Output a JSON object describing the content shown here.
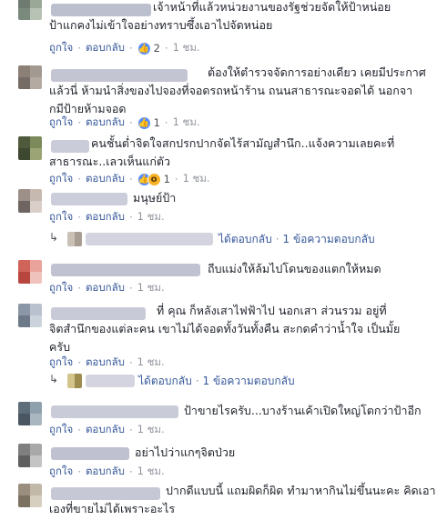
{
  "actions": {
    "like": "ถูกใจ",
    "reply": "ตอบกลับ",
    "dot": "·"
  },
  "colors": {
    "link": "#365899",
    "meta": "#90949c",
    "text": "#1d2129",
    "like_icon": "#5890ff",
    "wow_icon": "#f7b125"
  },
  "icons": {
    "like": "thumbs-up-icon",
    "wow": "wow-face-icon",
    "reply_arrow": "reply-arrow-icon"
  },
  "comments": [
    {
      "text": "เจ้าหน้าที่แล้วหน่วยงานของรัฐช่วยจัดให้ป้าหน่อย\nป้าแกคงไม่เข้าใจอย่างทราบซึ้งเอาไปจัดหน่อย",
      "reactions": "2",
      "time": "1 ชม.",
      "avatar": [
        "#6f7a70",
        "#9aa898",
        "#7a8a7d",
        "#b7c2b4"
      ],
      "name_blur": "#a6a9bd"
    },
    {
      "text": "ต้องให้ตำรวจจัดการอย่างเดียว เคยมีประกาศ\nแล้วนี่ ห้ามนำสิ่งของไปจองที่จอดรถหน้าร้าน ถนนสาธารณะจอดได้ นอกจา\nกมีป้ายห้ามจอด",
      "reactions": "1",
      "time": "1 ชม.",
      "avatar": [
        "#8c7f76",
        "#a29990",
        "#756c66",
        "#b5aaa2"
      ],
      "name_blur": "#b0b2c4"
    },
    {
      "text": "คนชั้นต่ำจิตใจสกปรกปากจัดไร้สามัญสำนึก..แจ้งความเลยคะที่\nสาธารณะ..เลวเห็นแก่ตัว",
      "reactions": "1",
      "time": "1 ชม.",
      "avatar": [
        "#4f5a3c",
        "#7c8a5b",
        "#3e4830",
        "#9aa474"
      ],
      "name_blur": "#b8bbcd"
    },
    {
      "text": "มนุษย์ป้า",
      "time": "1 ชม.",
      "avatar": [
        "#9c9088",
        "#c5b9b0",
        "#6e6562",
        "#d9cfc8"
      ],
      "name_blur": "#b9bccd"
    },
    {
      "text": "ถีบแม่งให้ล้มไปโดนของแตกให้หมด",
      "time": "1 ชม.",
      "avatar": [
        "#d0645a",
        "#e9a39b",
        "#b8463e",
        "#f0c2bc"
      ],
      "name_blur": "#abaec2"
    },
    {
      "text": "ที่ คุณ ก็หลังเสาไฟฟ้าไป นอกเสา ส่วนรวม อยู่ที่\nจิตสำนึกของแต่ละคน เขาไม่ได้จอดทั้งวันทั้งคืน สะกดคำว่าน้ำใจ เป็นมั้ย\nครับ",
      "time": "1 ชม.",
      "avatar": [
        "#8b96a6",
        "#b8c1cd",
        "#6d7888",
        "#ccd3dc"
      ],
      "name_blur": "#b5b8ca"
    },
    {
      "text": "ป้าขายไรครับ...บางร้านเค้าเปิดใหญ่โตกว่าป้าอีก",
      "time": "1 ชม.",
      "avatar": [
        "#5e6d7a",
        "#8fa0ad",
        "#4a5763",
        "#a9b7c1"
      ],
      "name_blur": "#b7bacc"
    },
    {
      "text": "อย่าไปว่าแกๆจิตป่วย",
      "time": "1 ชม.",
      "avatar": [
        "#7f7f7f",
        "#a8a8a8",
        "#5f5f5f",
        "#c4c4c4"
      ],
      "name_blur": "#a9abc0"
    },
    {
      "text": "ปากดีแบบนี้ แถมผิดก็ผิด ทำมาหากินไม่ขึ้นนะคะ คิดเอา\nเองที่ขายไม่ได้เพราะอะไร",
      "avatar": [
        "#9a8f7e",
        "#c2b8a8",
        "#7c7262",
        "#d6cebf"
      ],
      "name_blur": "#b3b6c8"
    }
  ],
  "reply_summaries": [
    {
      "replied": "ได้ตอบกลับ",
      "count": "1 ข้อความตอบกลับ",
      "avatar": [
        "#c9c0b6",
        "#a79d92"
      ],
      "name_blur": "#c4c6d6"
    },
    {
      "replied": "ได้ตอบกลับ",
      "count": "1 ข้อความตอบกลับ",
      "avatar": [
        "#d2c48a",
        "#9d8c4e"
      ],
      "name_blur": "#c4c6d6"
    }
  ]
}
